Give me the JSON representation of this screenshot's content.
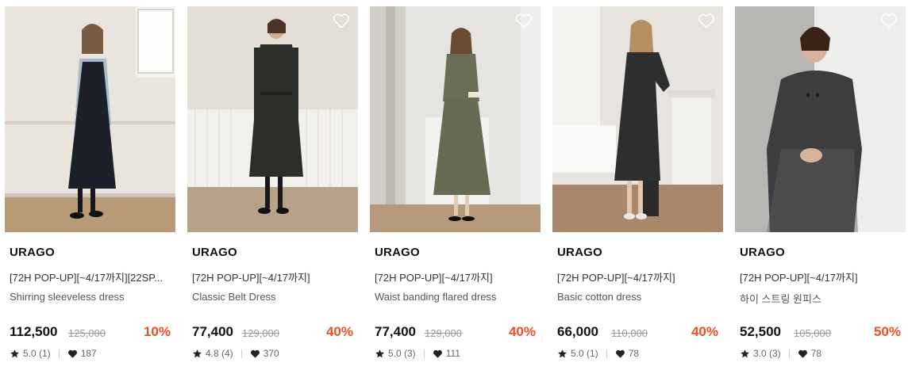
{
  "products": [
    {
      "brand": "URAGO",
      "name": "[72H POP-UP][~4/17까지][22SP...",
      "subname": "Shirring sleeveless dress",
      "price": "112,500",
      "original_price": "125,000",
      "discount": "10%",
      "rating": "5.0 (1)",
      "likes": "187"
    },
    {
      "brand": "URAGO",
      "name": "[72H POP-UP][~4/17까지]",
      "subname": "Classic Belt Dress",
      "price": "77,400",
      "original_price": "129,000",
      "discount": "40%",
      "rating": "4.8 (4)",
      "likes": "370"
    },
    {
      "brand": "URAGO",
      "name": "[72H POP-UP][~4/17까지]",
      "subname": "Waist banding flared dress",
      "price": "77,400",
      "original_price": "129,000",
      "discount": "40%",
      "rating": "5.0 (3)",
      "likes": "111"
    },
    {
      "brand": "URAGO",
      "name": "[72H POP-UP][~4/17까지]",
      "subname": "Basic cotton dress",
      "price": "66,000",
      "original_price": "110,000",
      "discount": "40%",
      "rating": "5.0 (1)",
      "likes": "78"
    },
    {
      "brand": "URAGO",
      "name": "[72H POP-UP][~4/17까지]",
      "subname": "하이 스트링 원피스",
      "price": "52,500",
      "original_price": "105,000",
      "discount": "50%",
      "rating": "3.0 (3)",
      "likes": "78"
    }
  ],
  "icons": {
    "wishlist": "heart-outline-icon",
    "rating": "star-icon",
    "likes": "heart-filled-icon"
  },
  "colors": {
    "discount": "#f04e23"
  }
}
